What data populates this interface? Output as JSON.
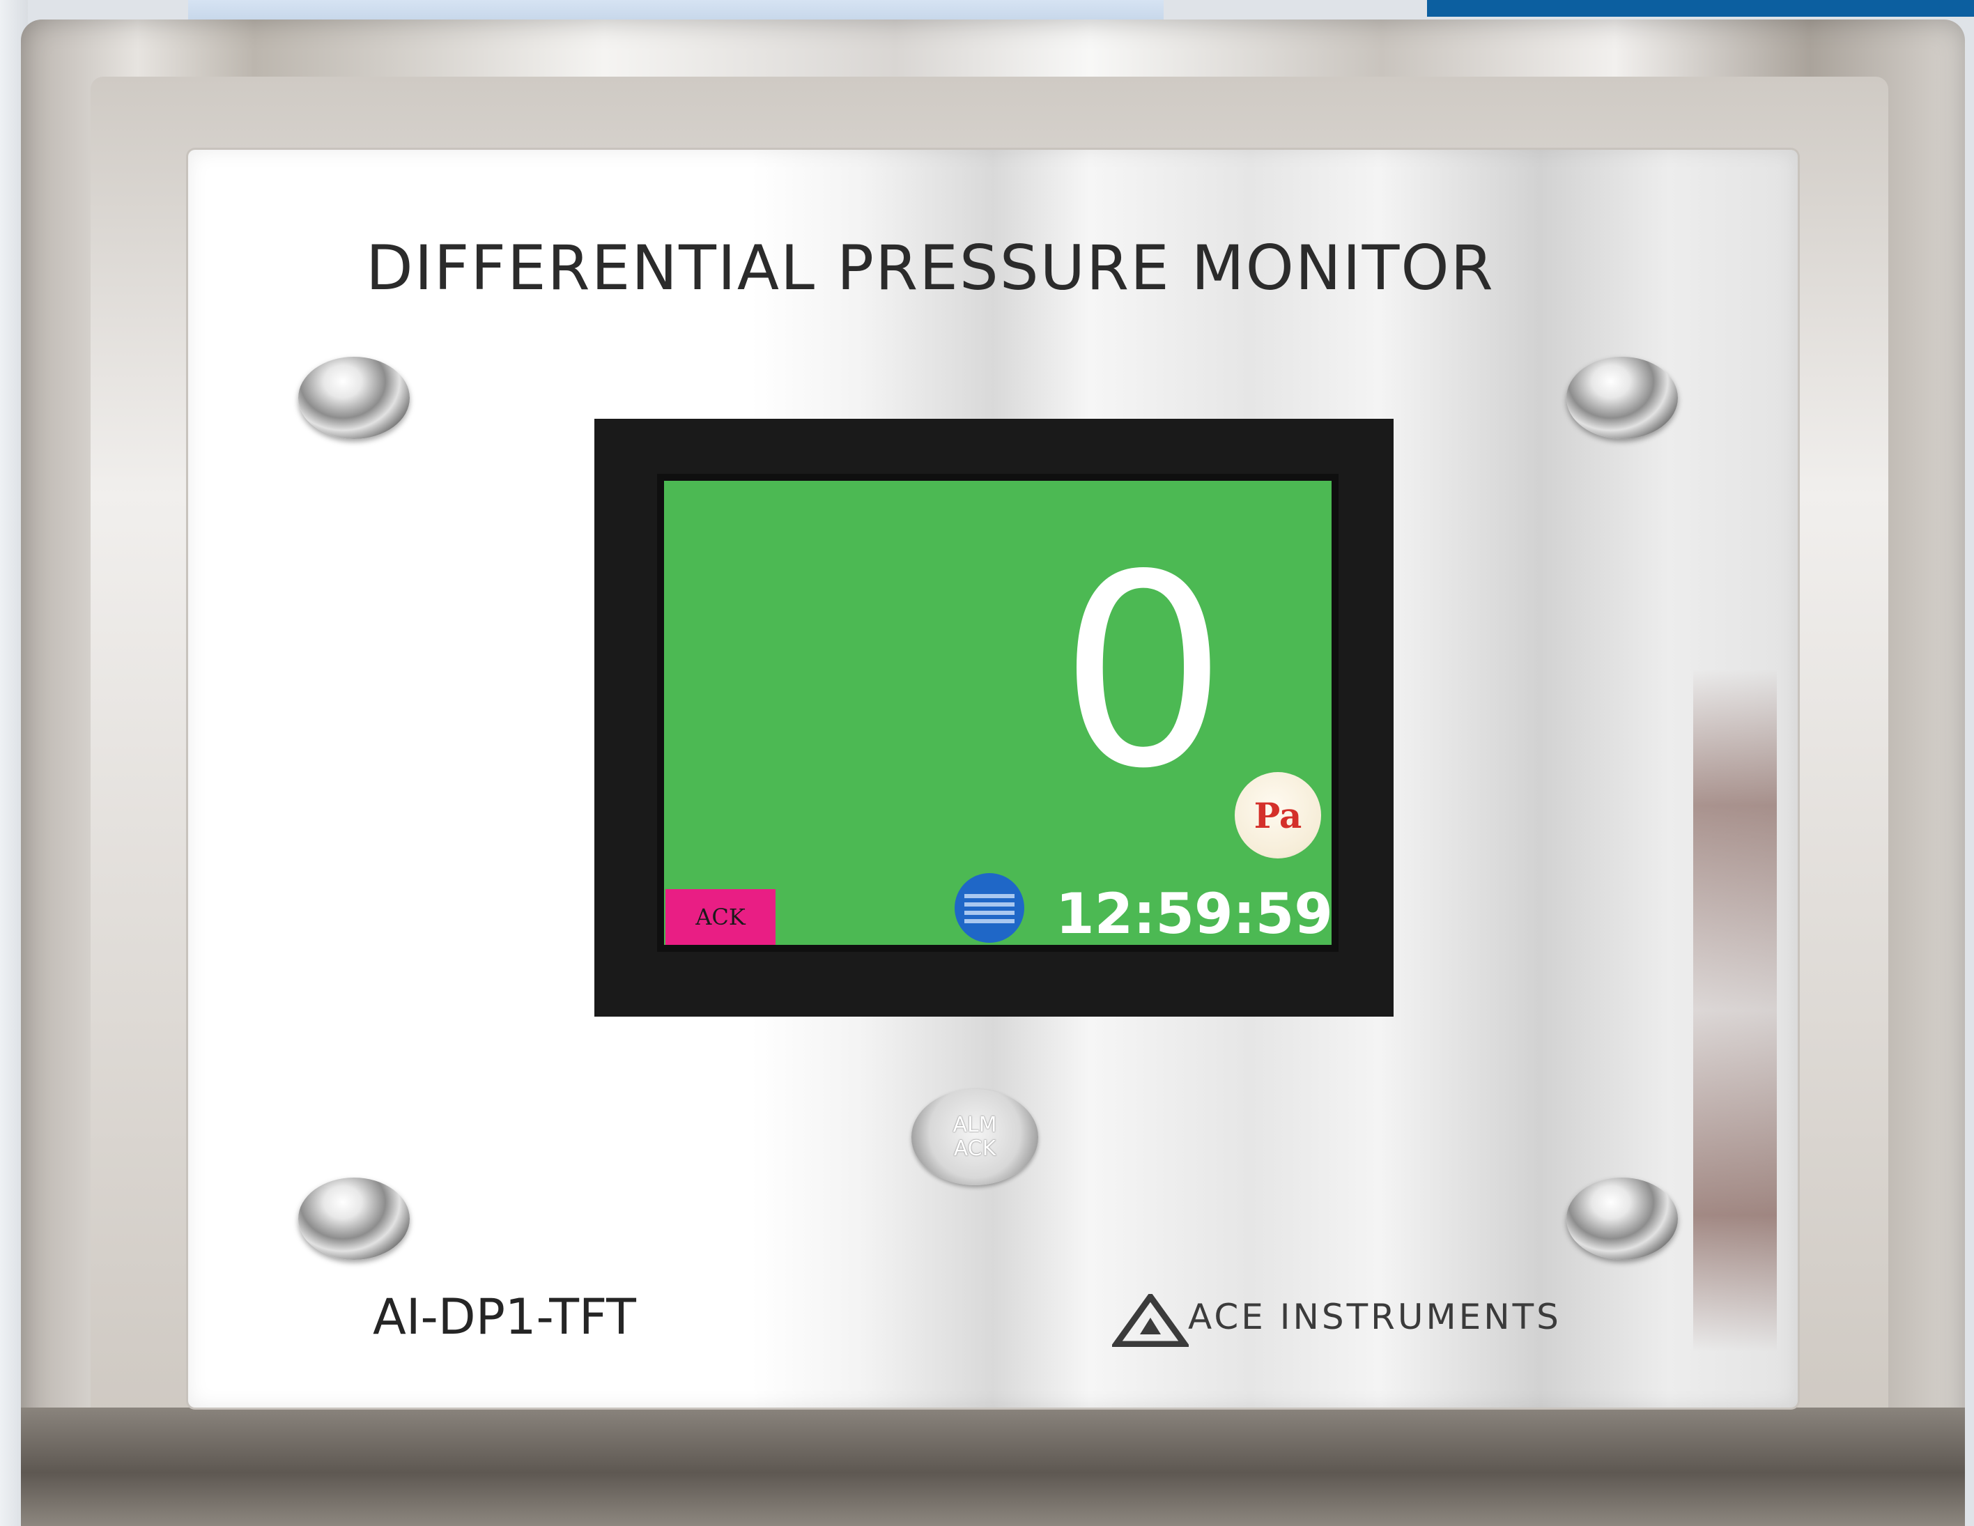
{
  "panel": {
    "title": "DIFFERENTIAL PRESSURE MONITOR",
    "model": "AI-DP1-TFT",
    "brand": "ACE INSTRUMENTS"
  },
  "display": {
    "reading": "0",
    "unit": "Pa",
    "ack_label": "ACK",
    "clock": "12:59:59",
    "background_color": "#4cb953",
    "ack_color": "#e91e84",
    "status_icon": "status-indicator-icon"
  },
  "buttons": {
    "alm_line1": "ALM",
    "alm_line2": "ACK"
  }
}
